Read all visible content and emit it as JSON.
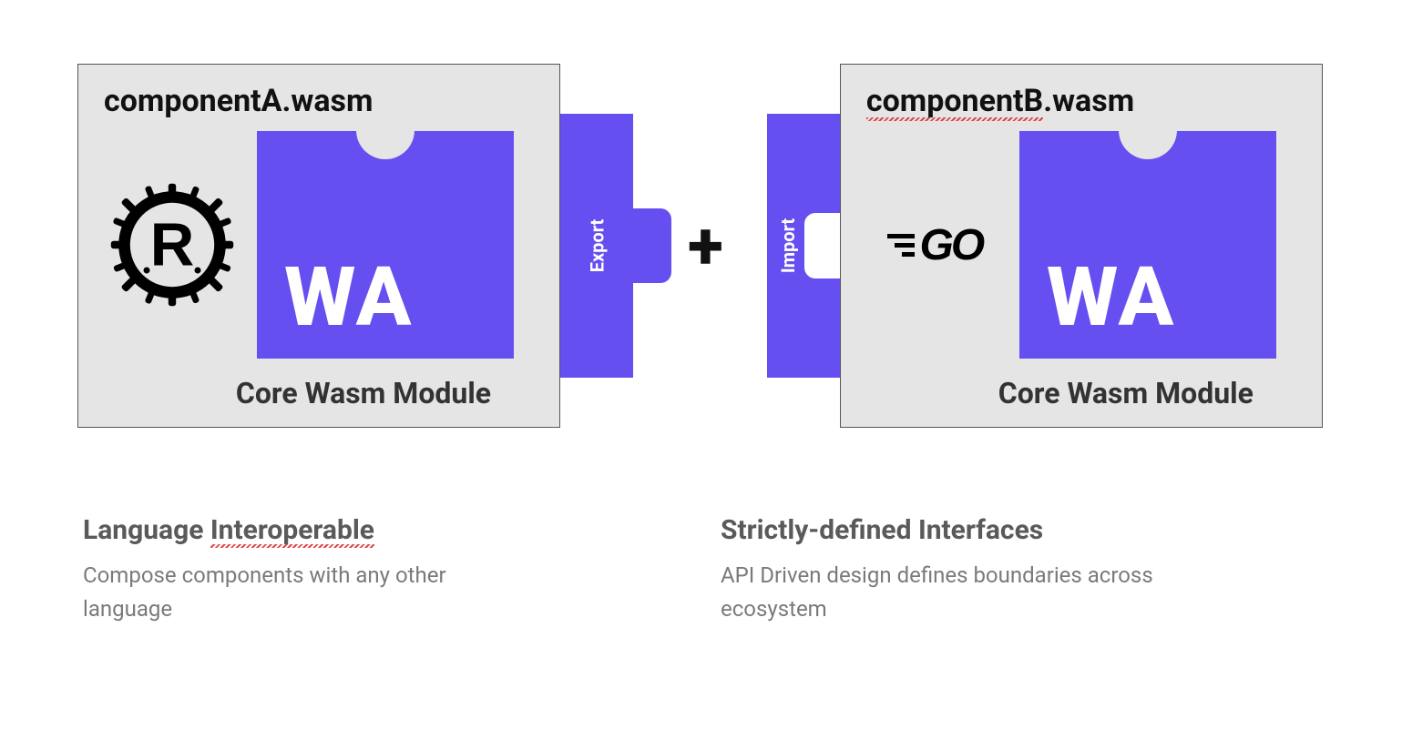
{
  "colors": {
    "wasm_purple": "#654FF0",
    "box_grey": "#e5e5e5"
  },
  "componentA": {
    "title": "componentA.wasm",
    "module_caption": "Core Wasm Module",
    "language": "Rust",
    "wa_label": "WA"
  },
  "connector": {
    "export_label": "Export",
    "plus": "+",
    "import_label": "Import"
  },
  "componentB": {
    "title_prefix": "componentB",
    "title_suffix": ".wasm",
    "module_caption": "Core Wasm Module",
    "language": "Go",
    "go_label": "GO",
    "wa_label": "WA"
  },
  "captions": {
    "left": {
      "title_prefix": "Language ",
      "title_underlined": "Interoperable",
      "body": "Compose components with any other language"
    },
    "right": {
      "title": "Strictly-defined Interfaces",
      "body": "API Driven design defines boundaries across ecosystem"
    }
  }
}
